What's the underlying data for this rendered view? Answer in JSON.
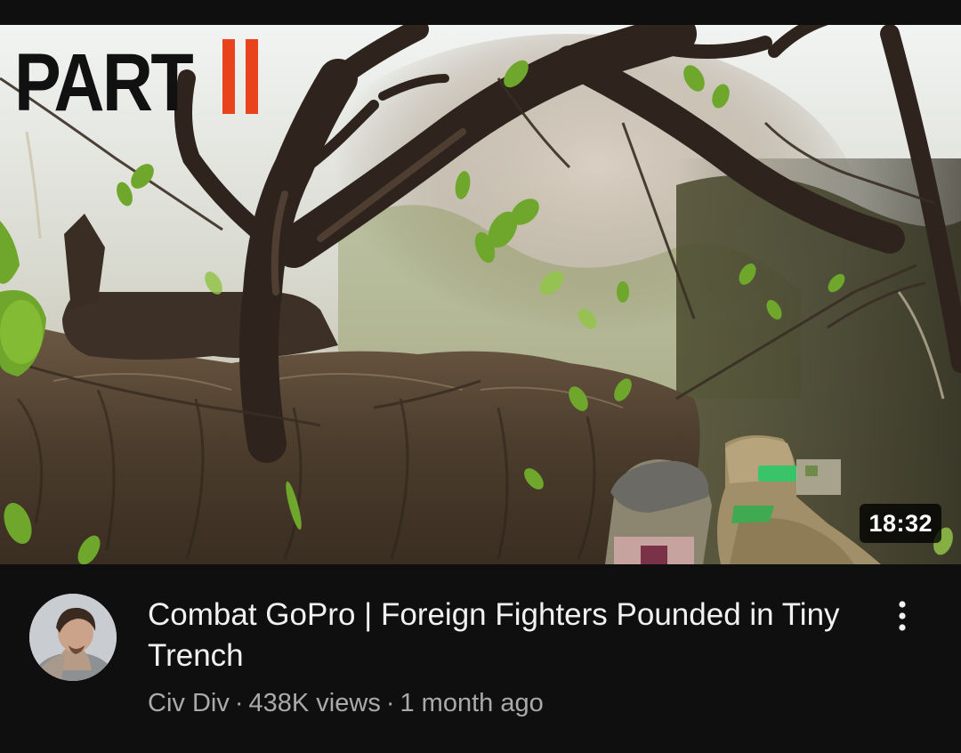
{
  "thumbnail": {
    "overlay_text": "PART",
    "overlay_numeral": "II",
    "duration": "18:32"
  },
  "video": {
    "title": "Combat GoPro | Foreign Fighters Pounded in Tiny Trench",
    "channel": "Civ Div",
    "views": "438K views",
    "age": "1 month ago",
    "separator": "·"
  },
  "icons": {
    "more": "more-vert-icon",
    "avatar": "channel-avatar"
  },
  "colors": {
    "background": "#0f0f0f",
    "title": "#f1f1f1",
    "meta": "#aaaaaa",
    "accent_part": "#e8431c"
  }
}
